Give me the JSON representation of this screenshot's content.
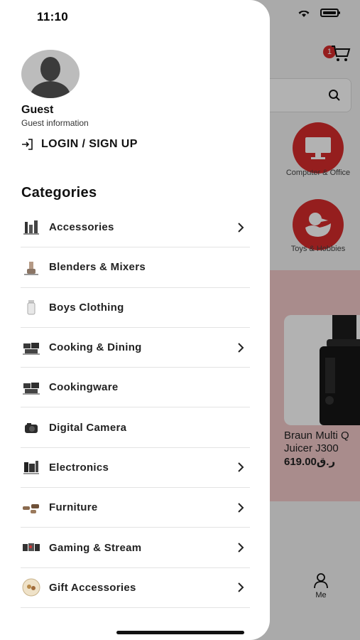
{
  "status": {
    "time": "11:10"
  },
  "profile": {
    "name": "Guest",
    "info": "Guest information",
    "login_label": "LOGIN / SIGN UP"
  },
  "categories_title": "Categories",
  "categories": [
    {
      "label": "Accessories",
      "has_submenu": true,
      "icon": "accessories-thumb"
    },
    {
      "label": "Blenders & Mixers",
      "has_submenu": false,
      "icon": "blender-thumb"
    },
    {
      "label": "Boys Clothing",
      "has_submenu": false,
      "icon": "clothing-thumb"
    },
    {
      "label": "Cooking & Dining",
      "has_submenu": true,
      "icon": "cookware-thumb"
    },
    {
      "label": "Cookingware",
      "has_submenu": false,
      "icon": "cookware-thumb"
    },
    {
      "label": "Digital Camera",
      "has_submenu": false,
      "icon": "camera-thumb"
    },
    {
      "label": "Electronics",
      "has_submenu": true,
      "icon": "electronics-thumb"
    },
    {
      "label": "Furniture",
      "has_submenu": true,
      "icon": "furniture-thumb"
    },
    {
      "label": "Gaming & Stream",
      "has_submenu": true,
      "icon": "gaming-thumb"
    },
    {
      "label": "Gift Accessories",
      "has_submenu": true,
      "icon": "gift-thumb"
    }
  ],
  "background": {
    "cart_count": "1",
    "categories": [
      "Computer & Office",
      "Toys & Hobbies"
    ],
    "product": {
      "name_line1": "Braun Multi Q",
      "name_line2": "Juicer J300",
      "price": "619.00ر.ق"
    },
    "tab_me": "Me"
  },
  "colors": {
    "accent": "#d62b2b",
    "promo": "#f2c9c9"
  }
}
